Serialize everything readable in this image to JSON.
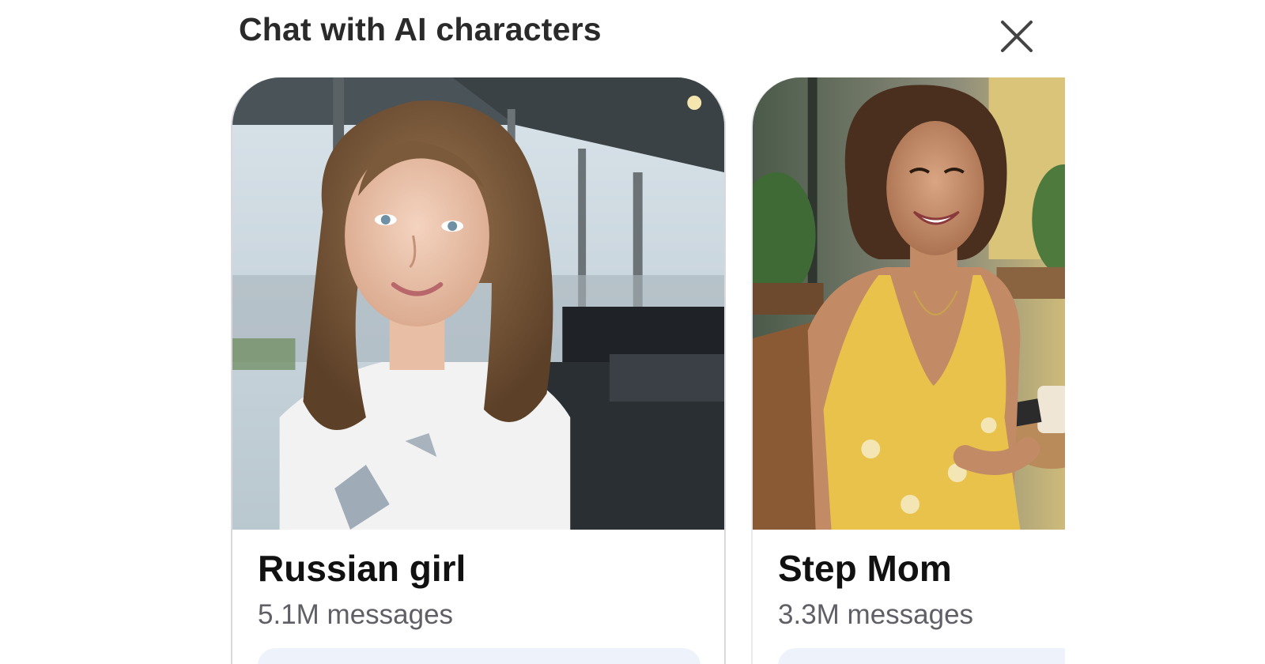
{
  "header": {
    "title": "Chat with AI characters",
    "close_icon": "close-icon"
  },
  "characters": [
    {
      "name": "Russian girl",
      "count": "5.1M messages",
      "photo": "portrait photo of smiling woman with curly hair in white t-shirt, office windows background"
    },
    {
      "name": "Step Mom",
      "count": "3.3M messages",
      "photo": "portrait photo of laughing woman in yellow floral dress at cafe table"
    }
  ],
  "colors": {
    "title": "#2a2a2a",
    "name": "#111111",
    "count": "#5f5f66",
    "button_bg": "#eef3fb",
    "card_border": "#e9e9ee"
  }
}
